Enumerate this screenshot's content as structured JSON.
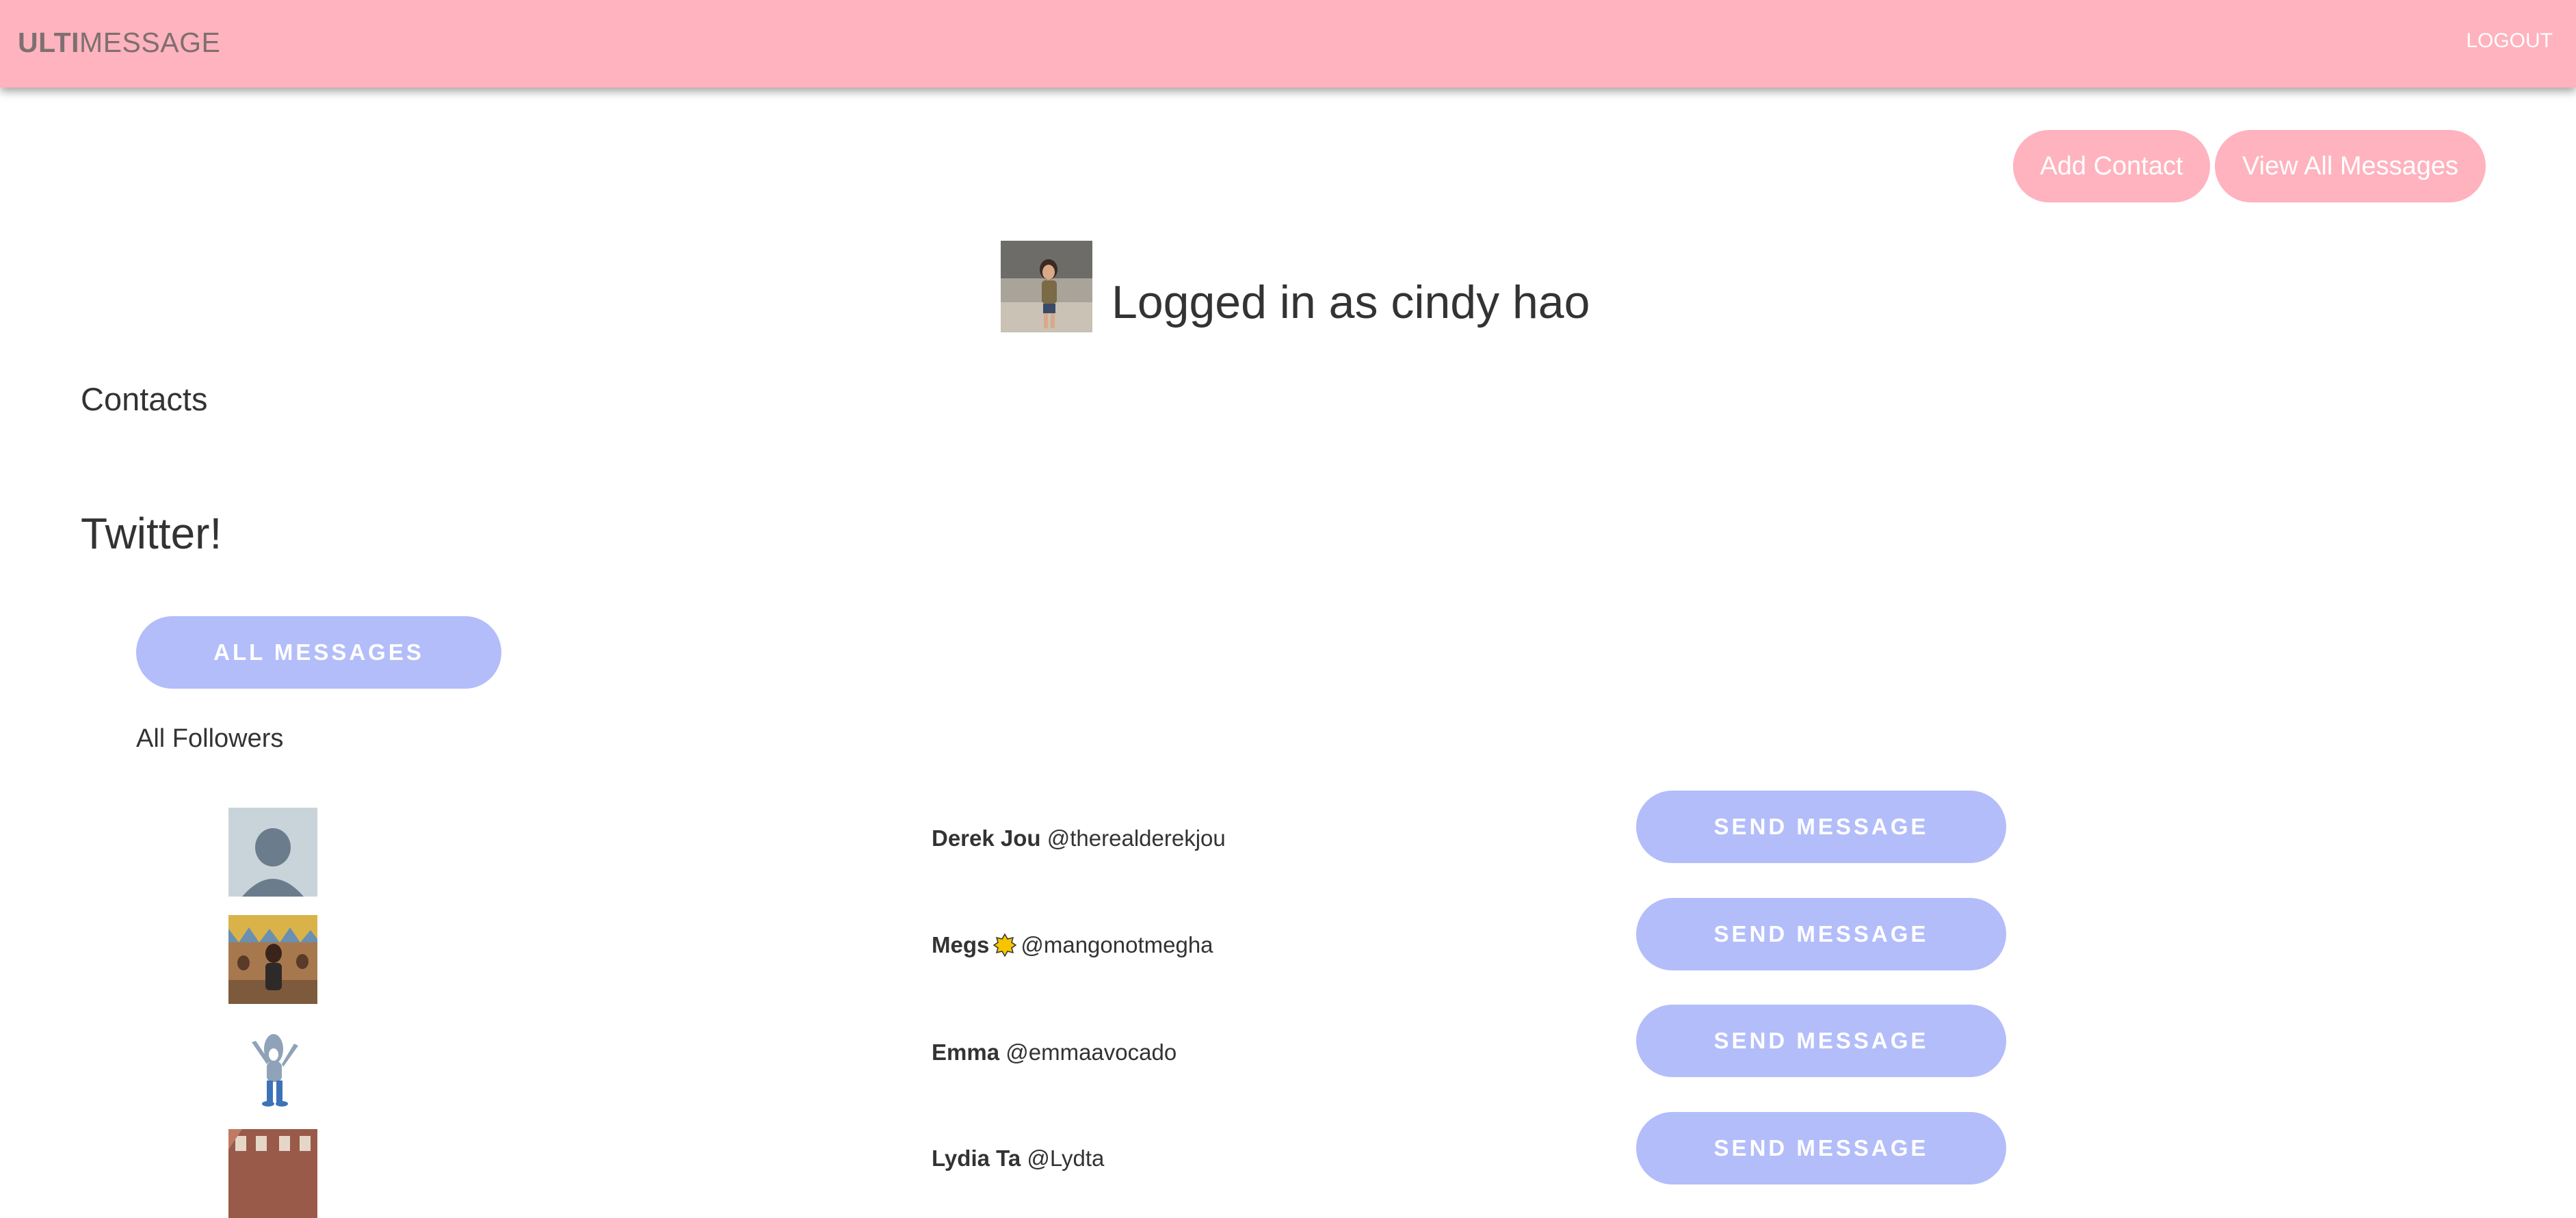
{
  "navbar": {
    "brand_bold": "ULTI",
    "brand_rest": "MESSAGE",
    "logout_label": "LOGOUT"
  },
  "actions": {
    "add_contact_label": "Add Contact",
    "view_all_label": "View All Messages"
  },
  "user": {
    "logged_in_text": "Logged in as cindy hao"
  },
  "contacts": {
    "title": "Contacts"
  },
  "twitter": {
    "title": "Twitter!",
    "all_messages_label": "ALL MESSAGES",
    "followers_title": "All Followers",
    "send_label": "SEND MESSAGE",
    "followers": [
      {
        "name": "Derek Jou",
        "handle": "@therealderekjou"
      },
      {
        "name": "Megs",
        "handle": "@mangonotmegha",
        "badge": "yellow-sun-emoji"
      },
      {
        "name": "Emma",
        "handle": "@emmaavocado"
      },
      {
        "name": "Lydia Ta",
        "handle": "@Lydta"
      }
    ]
  },
  "colors": {
    "navbar": "#ffb3be",
    "pink_button": "#ffb3be",
    "blue_button": "#b3bdfa"
  }
}
